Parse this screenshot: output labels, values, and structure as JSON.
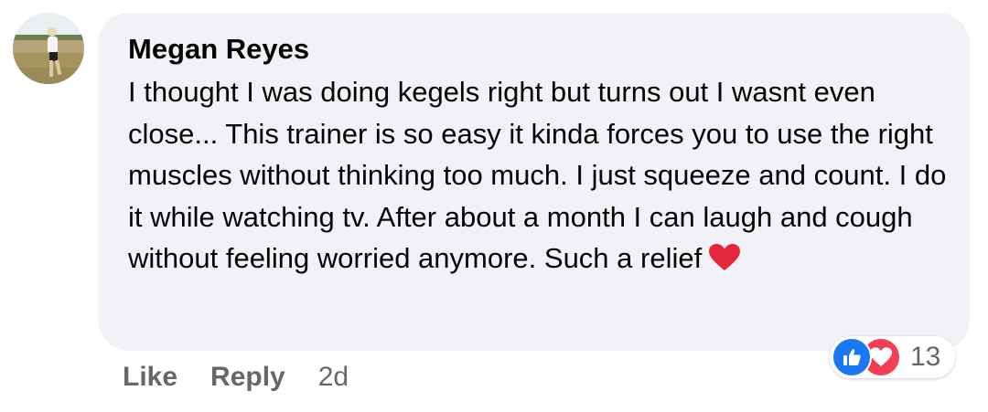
{
  "comment": {
    "author": "Megan Reyes",
    "text": "I thought I was doing kegels right but turns out I wasnt even close... This trainer is so easy it kinda forces you to use the right muscles without thinking too much. I just squeeze and count. I do it while watching tv. After about a month I can laugh and cough without feeling worried anymore. Such a relief",
    "emoji": "red-heart-icon",
    "timestamp": "2d"
  },
  "actions": {
    "like_label": "Like",
    "reply_label": "Reply"
  },
  "reactions": {
    "types": [
      "like-icon",
      "love-icon"
    ],
    "count": "13"
  },
  "colors": {
    "bubble_bg": "#f0f2f5",
    "like_blue": "#1877f2",
    "love_red": "#f33e58",
    "heart_red": "#e4263c",
    "secondary_text": "#65676b"
  }
}
